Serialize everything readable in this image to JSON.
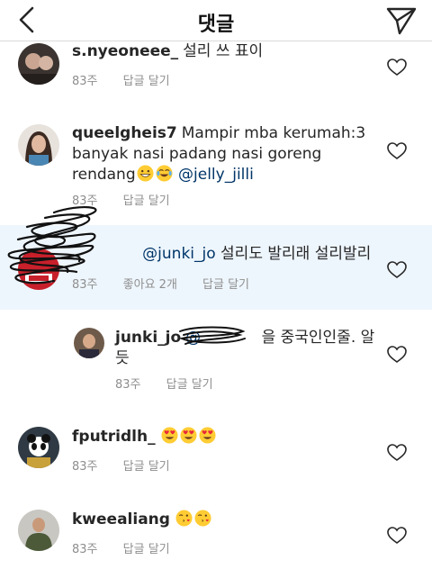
{
  "header": {
    "title": "댓글"
  },
  "comments": [
    {
      "username": "s.nyeoneee_",
      "text": "설리 쓰 표이",
      "time": "83주",
      "reply": "답글 달기"
    },
    {
      "username": "queelgheis7",
      "text_line1": "Mampir mba kerumah:3",
      "text_line2": "banyak nasi padang nasi goreng",
      "text_line3a": "rendang",
      "mention": "@jelly_jilli",
      "time": "83주",
      "reply": "답글 달기"
    },
    {
      "username": "junki_jo",
      "mention": "@junki_jo",
      "text": "설리도 발리래 설리발리",
      "time": "83주",
      "likes": "좋아요 2개",
      "reply": "답글 달기"
    },
    {
      "username": "junki_jo",
      "mention": "@",
      "text_line1_end": "을 중국인인줄. 알",
      "text_line2": "듯",
      "time": "83주",
      "reply": "답글 달기"
    },
    {
      "username": "fputridlh_",
      "time": "83주",
      "reply": "답글 달기"
    },
    {
      "username": "kweealiang",
      "time": "83주",
      "reply": "답글 달기"
    }
  ],
  "icons": {
    "back": "chevron-left-icon",
    "send": "paper-plane-icon",
    "heart": "heart-outline-icon"
  },
  "colors": {
    "highlight": "#eef6fd",
    "mention": "#003569",
    "meta": "#8e8e8e"
  }
}
